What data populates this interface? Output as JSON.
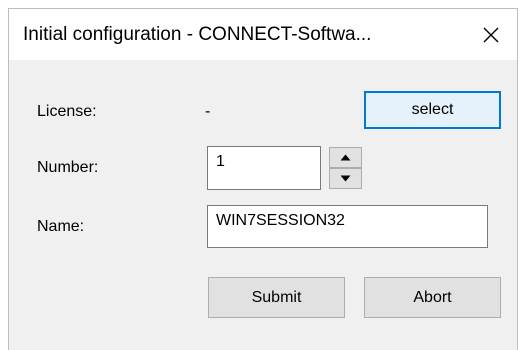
{
  "window": {
    "title": "Initial configuration - CONNECT-Softwa...",
    "close_icon": "close-icon"
  },
  "form": {
    "license_label": "License:",
    "license_value": "-",
    "select_label": "select",
    "number_label": "Number:",
    "number_value": "1",
    "name_label": "Name:",
    "name_value": "WIN7SESSION32",
    "submit_label": "Submit",
    "abort_label": "Abort"
  },
  "icons": {
    "spin_up": "chevron-up-icon",
    "spin_down": "chevron-down-icon"
  },
  "colors": {
    "accent": "#0078d7",
    "dialog_bg": "#f0f0f0"
  }
}
